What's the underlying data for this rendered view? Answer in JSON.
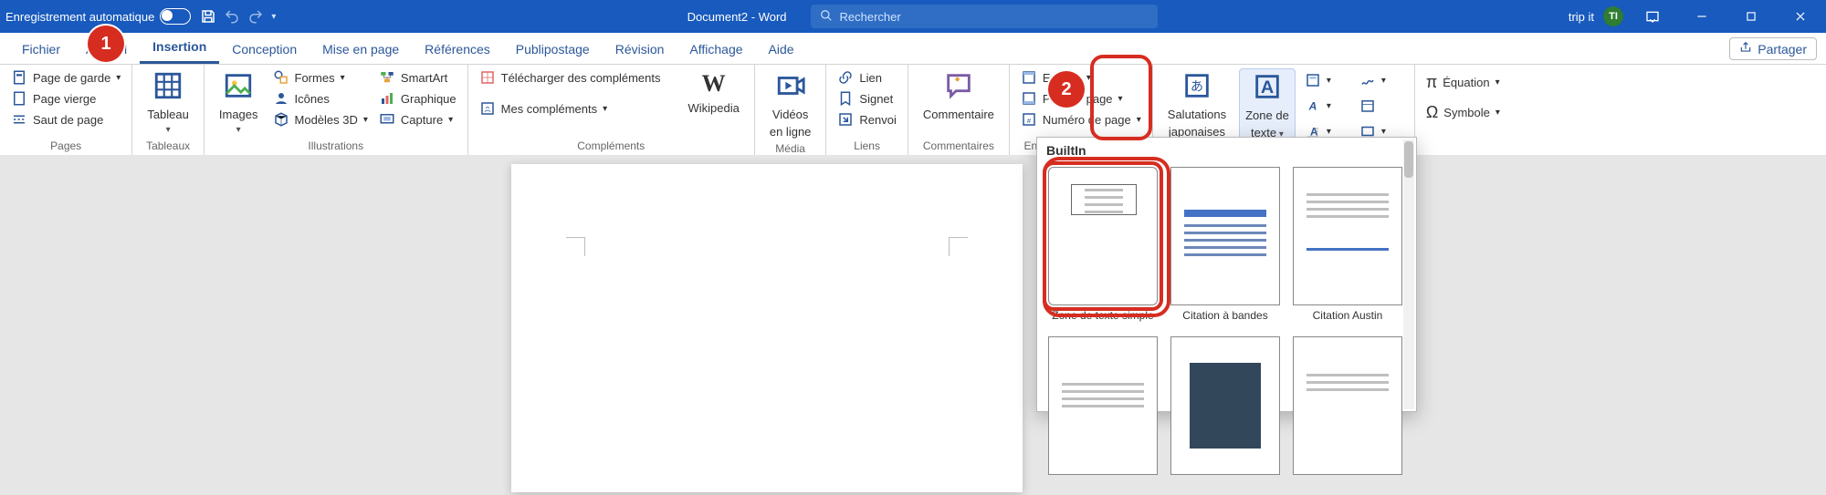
{
  "titlebar": {
    "autosave_label": "Enregistrement automatique",
    "doc_title": "Document2  -  Word",
    "search_placeholder": "Rechercher",
    "account_name": "trip it",
    "account_initials": "TI"
  },
  "tabs": {
    "items": [
      "Fichier",
      "Accueil",
      "Insertion",
      "Conception",
      "Mise en page",
      "Références",
      "Publipostage",
      "Révision",
      "Affichage",
      "Aide"
    ],
    "active_index": 2,
    "share_label": "Partager"
  },
  "ribbon": {
    "pages": {
      "label": "Pages",
      "cover_page": "Page de garde",
      "blank_page": "Page vierge",
      "page_break": "Saut de page"
    },
    "tables": {
      "label": "Tableaux",
      "table": "Tableau"
    },
    "illustrations": {
      "label": "Illustrations",
      "images": "Images",
      "shapes": "Formes",
      "icons": "Icônes",
      "models3d": "Modèles 3D",
      "smartart": "SmartArt",
      "chart": "Graphique",
      "capture": "Capture"
    },
    "addins": {
      "label": "Compléments",
      "get": "Télécharger des compléments",
      "my": "Mes compléments",
      "wikipedia": "Wikipedia"
    },
    "media": {
      "label": "Média",
      "online_video_l1": "Vidéos",
      "online_video_l2": "en ligne"
    },
    "links": {
      "label": "Liens",
      "link": "Lien",
      "bookmark": "Signet",
      "crossref": "Renvoi"
    },
    "comments": {
      "label": "Commentaires",
      "comment": "Commentaire"
    },
    "headerfooter": {
      "label": "En-tête et pied de page",
      "header": "En-tête",
      "footer": "Pied de page",
      "pagenum": "Numéro de page"
    },
    "text": {
      "salutations_l1": "Salutations",
      "salutations_l2": "japonaises",
      "textbox_l1": "Zone de",
      "textbox_l2": "texte"
    },
    "symbols": {
      "equation": "Équation",
      "symbol": "Symbole"
    }
  },
  "gallery": {
    "heading": "BuiltIn",
    "items": [
      {
        "label": "Zone de texte simple"
      },
      {
        "label": "Citation à bandes"
      },
      {
        "label": "Citation Austin"
      },
      {
        "label": ""
      },
      {
        "label": ""
      },
      {
        "label": ""
      }
    ],
    "selected_index": 0
  },
  "callouts": {
    "c1": "1",
    "c2": "2"
  }
}
